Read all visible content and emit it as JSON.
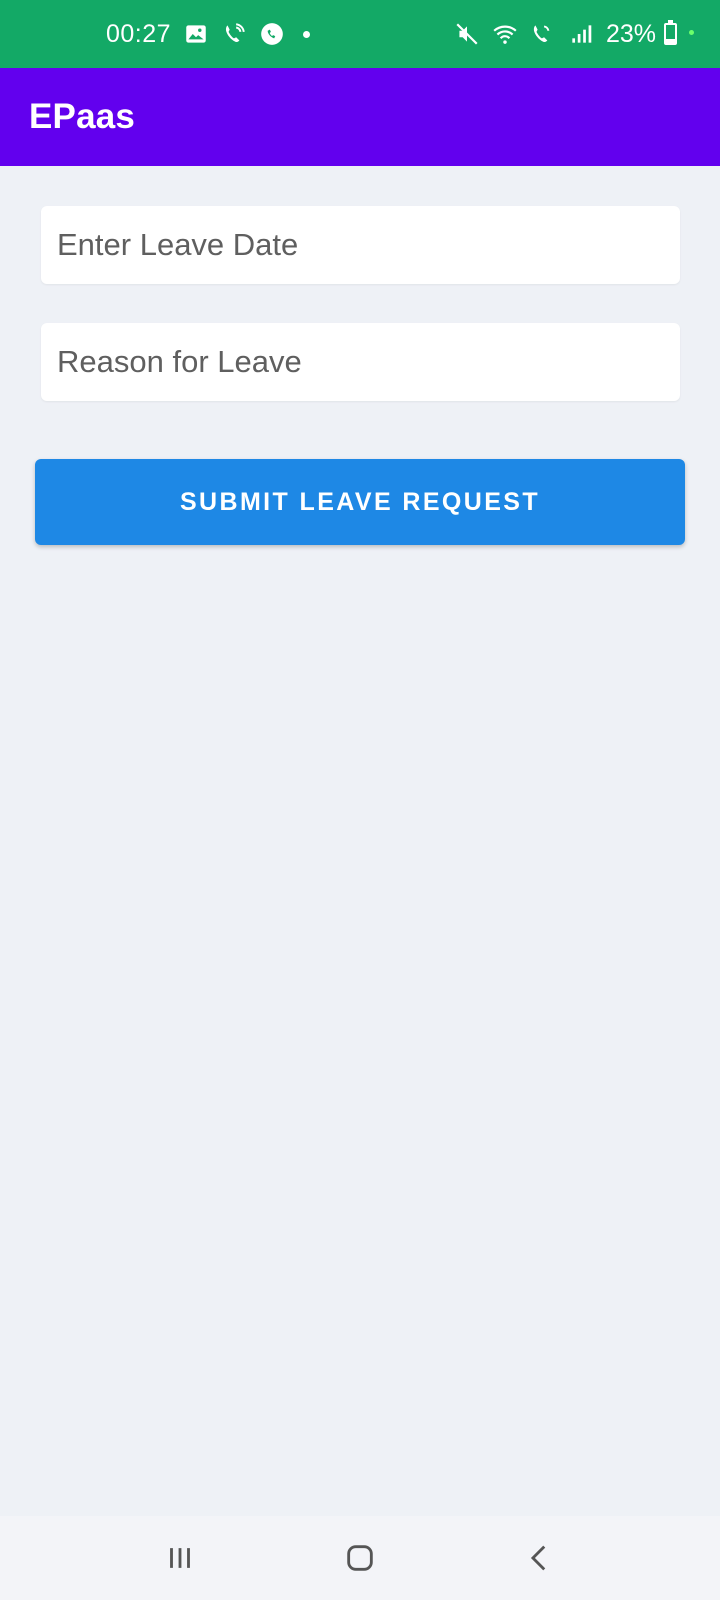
{
  "status_bar": {
    "time": "00:27",
    "battery_percent": "23%",
    "battery_level": 0.23,
    "icons_left": [
      "gallery-icon",
      "wifi-call-icon",
      "messenger-icon",
      "notification-dot-icon"
    ],
    "icons_right": [
      "mute-icon",
      "wifi-icon",
      "volte-call-icon",
      "signal-icon",
      "battery-icon"
    ],
    "background_color": "#13a966"
  },
  "app_bar": {
    "title": "EPaas",
    "background_color": "#6200ee"
  },
  "form": {
    "leave_date": {
      "value": "",
      "placeholder": "Enter Leave Date"
    },
    "reason": {
      "value": "",
      "placeholder": "Reason for Leave"
    },
    "submit_label": "SUBMIT LEAVE REQUEST",
    "submit_color": "#1e88e5"
  },
  "nav_bar": {
    "buttons": [
      "recent-apps-icon",
      "home-icon",
      "back-icon"
    ]
  }
}
